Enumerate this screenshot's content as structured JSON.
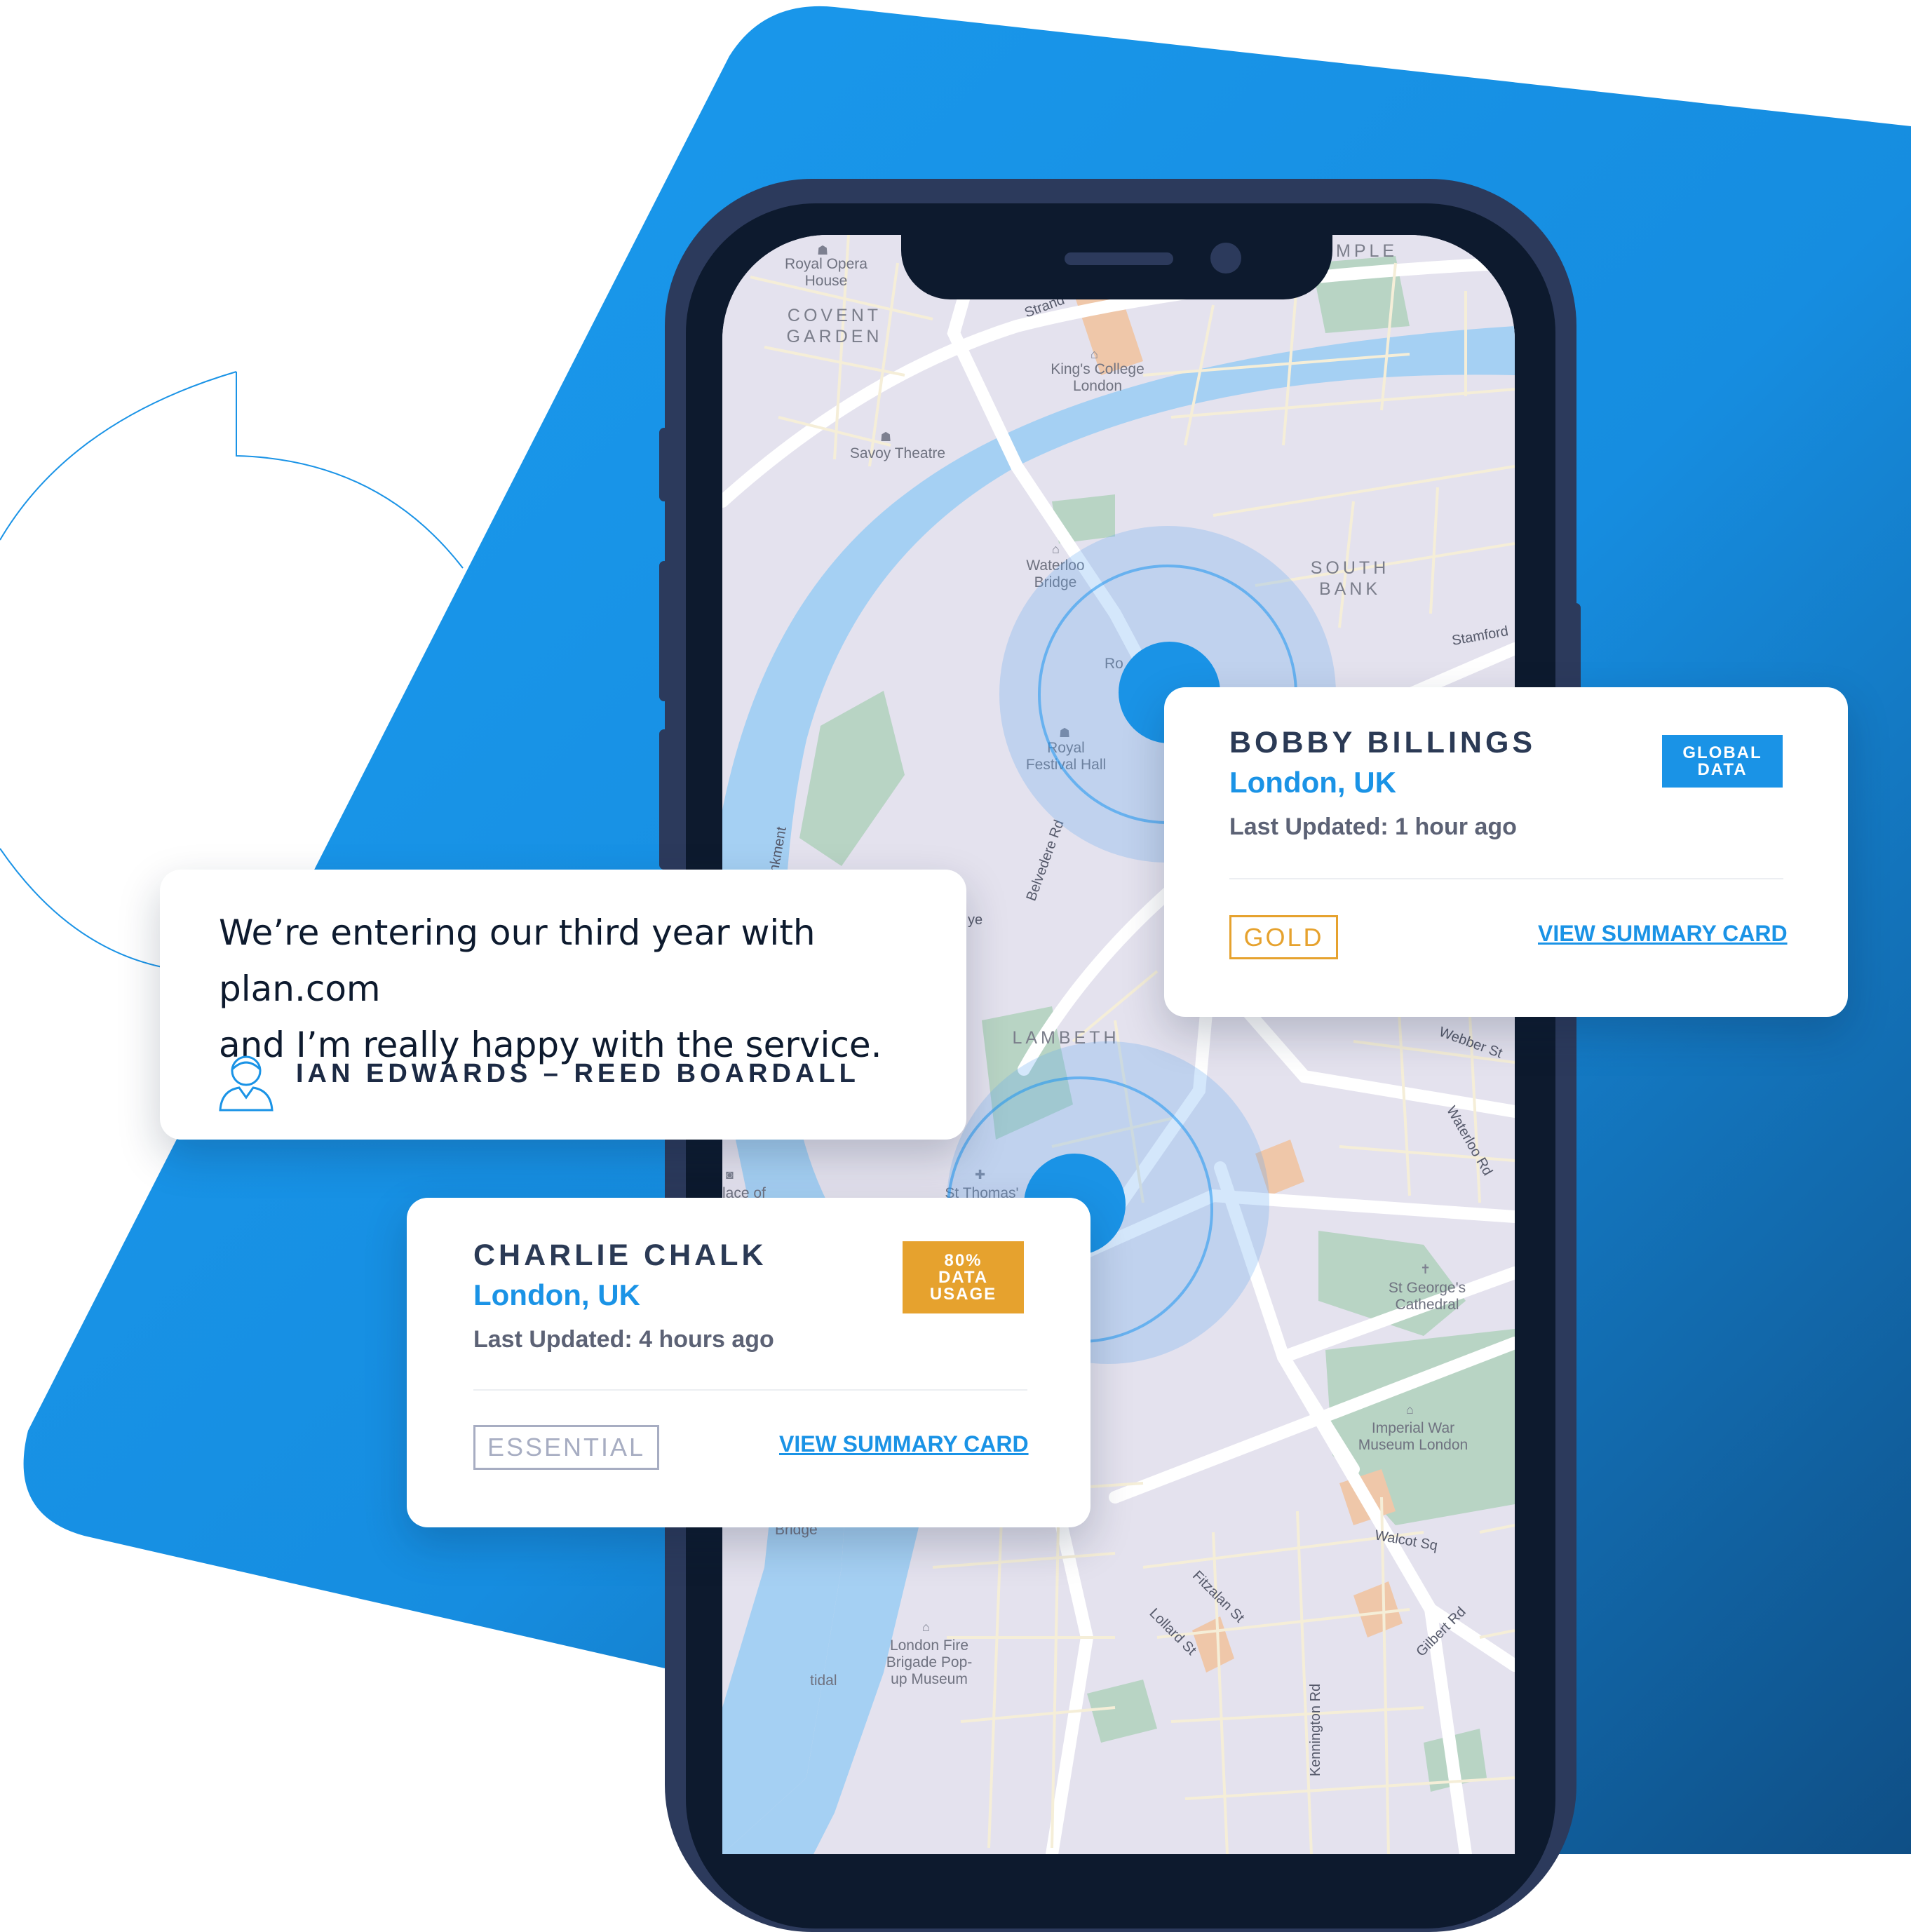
{
  "colors": {
    "brand_blue": "#1a93e6",
    "phone_frame": "#2c3a5c",
    "gold": "#e6a22e",
    "essential_grey": "#a7adc2",
    "water": "#a5d0f3",
    "park": "#b8d4c4"
  },
  "map": {
    "labels": {
      "royal_opera_house": "Royal Opera\nHouse",
      "covent_garden": "COVENT\nGARDEN",
      "strand": "Strand",
      "temple": "MPLE",
      "kings_college": "King's College\nLondon",
      "savoy_theatre": "Savoy Theatre",
      "waterloo_bridge": "Waterloo\nBridge",
      "south_bank": "SOUTH\nBANK",
      "stamford": "Stamford",
      "royal_festival_hall": "Royal\nFestival Hall",
      "ro": "Ro",
      "embankment": "ankment",
      "belvedere_rd": "Belvedere Rd",
      "ye": "ye",
      "lambeth": "LAMBETH",
      "webber_st": "Webber St",
      "waterloo_rd": "Waterloo Rd",
      "place_of": "lace of",
      "st_thomas": "St Thomas'",
      "st_georges": "St George's\nCathedral",
      "imperial_war_museum": "Imperial War\nMuseum London",
      "walcot_sq": "Walcot Sq",
      "fitzalan_st": "Fitzalan St",
      "lollard_st": "Lollard St",
      "gilbert_rd": "Gilbert Rd",
      "london_fire_brigade": "London Fire\nBrigade Pop-\nup Museum",
      "kennington_rd": "Kennington Rd",
      "bridge": "Bridge",
      "tidal": "tidal"
    }
  },
  "quote": {
    "text": "We’re entering our third year with plan.com\nand I’m really happy with the service.",
    "author": "IAN EDWARDS – REED BOARDALL",
    "icon": "person-icon"
  },
  "cards": {
    "bobby": {
      "name": "BOBBY BILLINGS",
      "location": "London, UK",
      "last_updated": "Last Updated: 1 hour ago",
      "badge": "GLOBAL\nDATA",
      "plan": "GOLD",
      "link": "VIEW SUMMARY CARD"
    },
    "charlie": {
      "name": "CHARLIE CHALK",
      "location": "London, UK",
      "last_updated": "Last Updated: 4 hours ago",
      "badge": "80%\nDATA\nUSAGE",
      "plan": "ESSENTIAL",
      "link": "VIEW SUMMARY CARD"
    }
  }
}
